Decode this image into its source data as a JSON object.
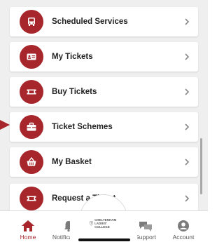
{
  "menu": {
    "items": [
      {
        "label": "Scheduled Services",
        "icon": "bus-icon"
      },
      {
        "label": "My Tickets",
        "icon": "id-card-icon"
      },
      {
        "label": "Buy Tickets",
        "icon": "ticket-icon"
      },
      {
        "label": "Ticket Schemes",
        "icon": "briefcase-icon"
      },
      {
        "label": "My Basket",
        "icon": "basket-icon"
      },
      {
        "label": "Request a Ticket",
        "icon": "ticket-icon"
      }
    ]
  },
  "tabbar": {
    "home_label": "Home",
    "notifications_label": "Notifications",
    "support_label": "Support",
    "account_label": "Account",
    "logo_text": "CHELTENHAM LADIES' COLLEGE"
  },
  "colors": {
    "accent": "#a6262b",
    "background": "#efeff0",
    "card": "#ffffff"
  }
}
